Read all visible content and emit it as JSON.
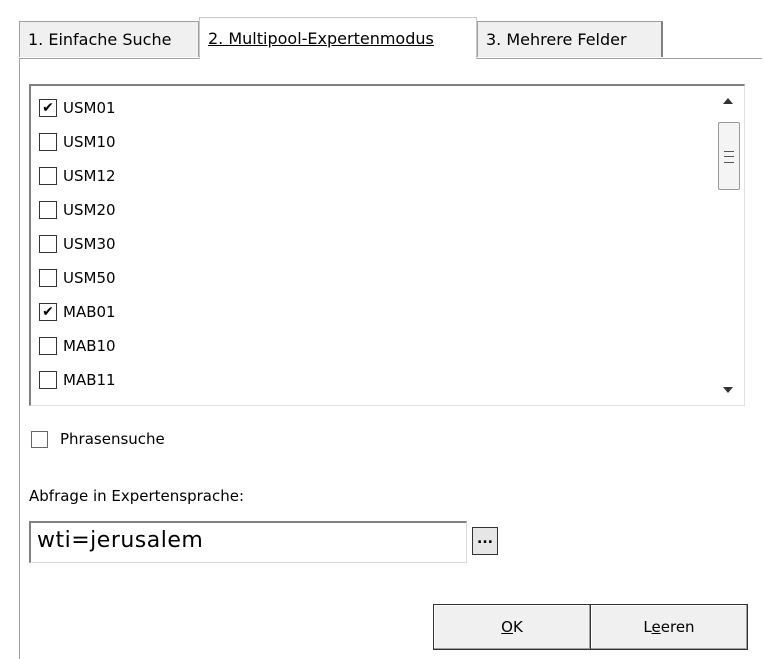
{
  "tabs": [
    {
      "label": "1. Einfache Suche",
      "active": false
    },
    {
      "label": "2. Multipool-Expertenmodus",
      "active": true
    },
    {
      "label": "3. Mehrere Felder",
      "active": false
    }
  ],
  "list": {
    "items": [
      {
        "label": "USM01",
        "checked": true
      },
      {
        "label": "USM10",
        "checked": false
      },
      {
        "label": "USM12",
        "checked": false
      },
      {
        "label": "USM20",
        "checked": false
      },
      {
        "label": "USM30",
        "checked": false
      },
      {
        "label": "USM50",
        "checked": false
      },
      {
        "label": "MAB01",
        "checked": true
      },
      {
        "label": "MAB10",
        "checked": false
      },
      {
        "label": "MAB11",
        "checked": false
      }
    ]
  },
  "phrase": {
    "label": "Phrasensuche",
    "checked": false
  },
  "expert": {
    "label": "Abfrage in Expertensprache:",
    "value": "wti=jerusalem",
    "browse_label": "..."
  },
  "buttons": {
    "ok_label_accel": "O",
    "ok_label_rest": "K",
    "clear_label_pre": "L",
    "clear_label_accel": "e",
    "clear_label_rest": "eren"
  },
  "check_glyph": "✔"
}
